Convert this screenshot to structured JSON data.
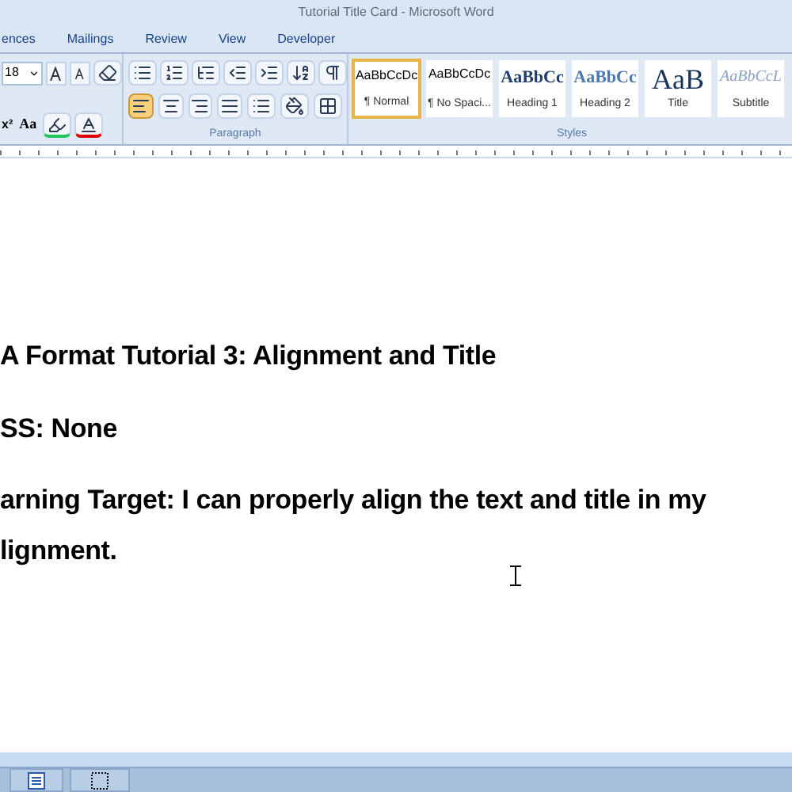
{
  "window": {
    "title": "Tutorial Title Card - Microsoft Word"
  },
  "tabs": [
    {
      "label": "ences",
      "selected": false
    },
    {
      "label": "Mailings",
      "selected": false
    },
    {
      "label": "Review",
      "selected": false
    },
    {
      "label": "View",
      "selected": false
    },
    {
      "label": "Developer",
      "selected": false
    }
  ],
  "ribbon": {
    "font": {
      "size": "18",
      "superscript": "x²",
      "change_case": "Aa"
    },
    "paragraph": {
      "label": "Paragraph",
      "alignment": [
        {
          "selected": true
        },
        {
          "selected": false
        },
        {
          "selected": false
        },
        {
          "selected": false
        }
      ]
    },
    "styles": {
      "label": "Styles",
      "items": [
        {
          "preview": "AaBbCcDc",
          "name": "¶ Normal",
          "kind": "normal",
          "selected": true
        },
        {
          "preview": "AaBbCcDc",
          "name": "¶ No Spaci...",
          "kind": "normal",
          "selected": false
        },
        {
          "preview": "AaBbCc",
          "name": "Heading 1",
          "kind": "heading1",
          "selected": false
        },
        {
          "preview": "AaBbCc",
          "name": "Heading 2",
          "kind": "heading2",
          "selected": false
        },
        {
          "preview": "AaB",
          "name": "Title",
          "kind": "title",
          "selected": false
        },
        {
          "preview": "AaBbCcL",
          "name": "Subtitle",
          "kind": "subtitle",
          "selected": false
        }
      ]
    }
  },
  "document": {
    "paragraphs": [
      "A Format Tutorial 3: Alignment and Title",
      "SS: None",
      "arning Target: I can properly align the text and title in my",
      "lignment."
    ]
  }
}
